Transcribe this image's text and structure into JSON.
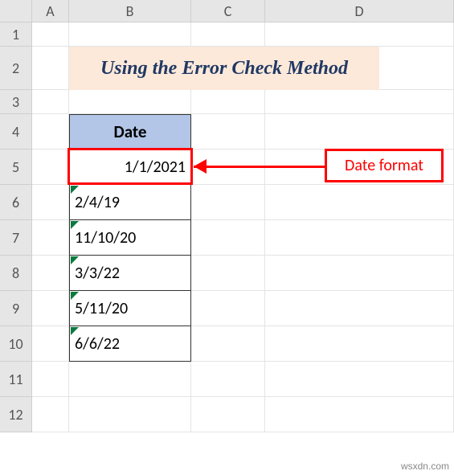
{
  "cols": [
    "A",
    "B",
    "C",
    "D"
  ],
  "rows": [
    "1",
    "2",
    "3",
    "4",
    "5",
    "6",
    "7",
    "8",
    "9",
    "10",
    "11",
    "12"
  ],
  "title": "Using the Error Check Method",
  "header": "Date",
  "data": {
    "b5": "1/1/2021",
    "b6": "2/4/19",
    "b7": "11/10/20",
    "b8": "3/3/22",
    "b9": "5/11/20",
    "b10": "6/6/22"
  },
  "callout": "Date format",
  "watermark": "wsxdn.com"
}
